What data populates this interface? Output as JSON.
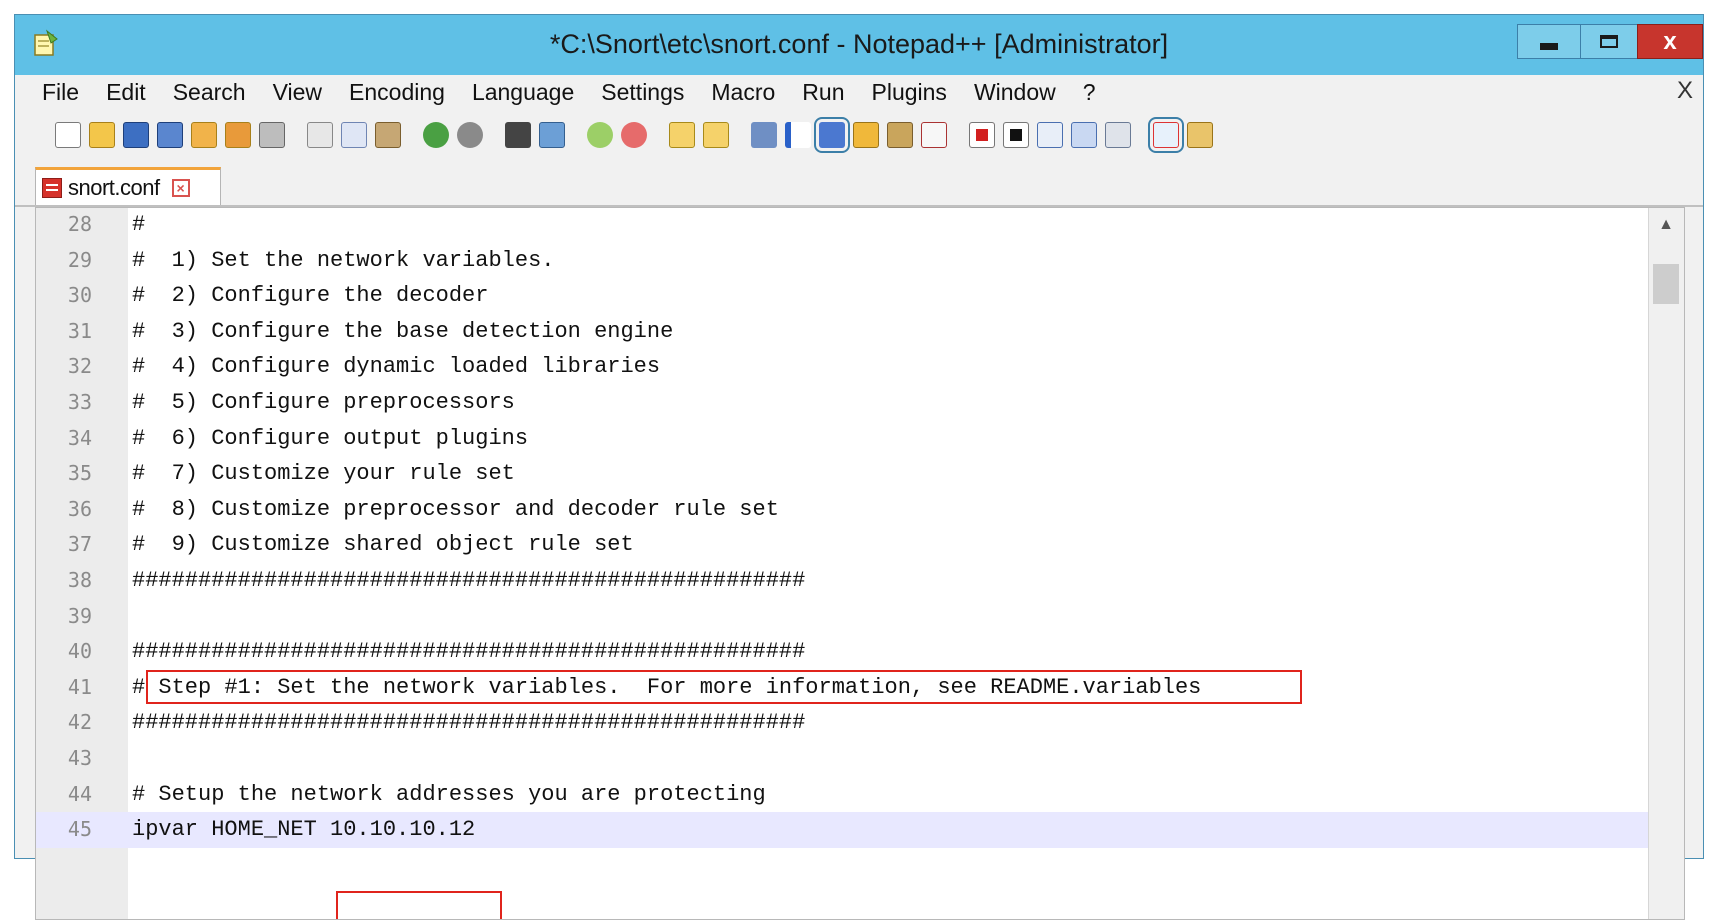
{
  "window": {
    "title": "*C:\\Snort\\etc\\snort.conf - Notepad++ [Administrator]",
    "close_glyph": "x"
  },
  "menu": {
    "items": [
      "File",
      "Edit",
      "Search",
      "View",
      "Encoding",
      "Language",
      "Settings",
      "Macro",
      "Run",
      "Plugins",
      "Window",
      "?"
    ],
    "doc_close": "X"
  },
  "toolbar": {
    "icons": [
      "new-file-icon",
      "open-file-icon",
      "save-icon",
      "save-all-icon",
      "close-icon",
      "close-all-icon",
      "print-icon",
      "cut-icon",
      "copy-icon",
      "paste-icon",
      "undo-icon",
      "redo-icon",
      "find-icon",
      "replace-icon",
      "zoom-in-icon",
      "zoom-out-icon",
      "sync-vertical-icon",
      "sync-horizontal-icon",
      "word-wrap-icon",
      "show-all-chars-icon",
      "indent-guide-icon",
      "document-map-icon",
      "function-list-icon",
      "monitor-icon",
      "record-macro-icon",
      "stop-macro-icon",
      "play-macro-icon",
      "run-macro-multiple-icon",
      "save-macro-icon",
      "spell-check-icon",
      "spell-options-icon"
    ]
  },
  "tab": {
    "label": "snort.conf"
  },
  "editor": {
    "lines": [
      {
        "n": "28",
        "t": "#"
      },
      {
        "n": "29",
        "t": "#  1) Set the network variables."
      },
      {
        "n": "30",
        "t": "#  2) Configure the decoder"
      },
      {
        "n": "31",
        "t": "#  3) Configure the base detection engine"
      },
      {
        "n": "32",
        "t": "#  4) Configure dynamic loaded libraries"
      },
      {
        "n": "33",
        "t": "#  5) Configure preprocessors"
      },
      {
        "n": "34",
        "t": "#  6) Configure output plugins"
      },
      {
        "n": "35",
        "t": "#  7) Customize your rule set"
      },
      {
        "n": "36",
        "t": "#  8) Customize preprocessor and decoder rule set"
      },
      {
        "n": "37",
        "t": "#  9) Customize shared object rule set"
      },
      {
        "n": "38",
        "t": "###################################################"
      },
      {
        "n": "39",
        "t": ""
      },
      {
        "n": "40",
        "t": "###################################################"
      },
      {
        "n": "41",
        "t": "# Step #1: Set the network variables.  For more information, see README.variables"
      },
      {
        "n": "42",
        "t": "###################################################"
      },
      {
        "n": "43",
        "t": ""
      },
      {
        "n": "44",
        "t": "# Setup the network addresses you are protecting"
      },
      {
        "n": "45",
        "t": "ipvar HOME_NET 10.10.10.12"
      }
    ]
  },
  "colors": {
    "titlebar": "#5fc0e6",
    "close_button": "#c7352d",
    "highlight_box": "#e0241c",
    "tab_accent": "#f2a43b"
  }
}
